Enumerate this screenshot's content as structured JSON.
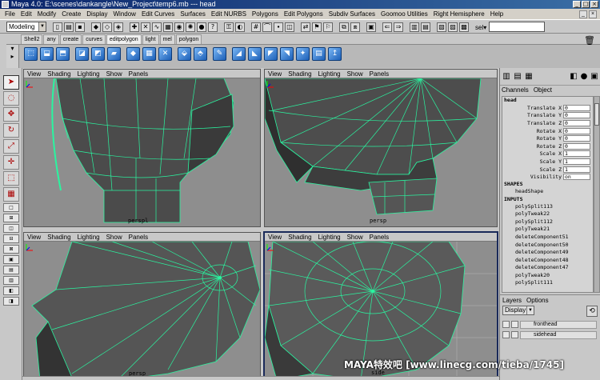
{
  "window": {
    "title": "Maya 4.0: E:\\scenes\\dankangle\\New_Project\\temp6.mb   ---   head",
    "controls": [
      "_",
      "□",
      "×"
    ]
  },
  "menubar": [
    "File",
    "Edit",
    "Modify",
    "Create",
    "Display",
    "Window",
    "Edit Curves",
    "Surfaces",
    "Edit NURBS",
    "Polygons",
    "Edit Polygons",
    "Subdiv Surfaces",
    "Goomoo Utilities",
    "Right Hemisphere",
    "Help"
  ],
  "status": {
    "mode": "Modeling",
    "select_label": "sel▾"
  },
  "shelf": {
    "tabs": [
      "Shell2",
      "any",
      "create",
      "curves",
      "editpolygon",
      "light",
      "mel",
      "polygon"
    ],
    "active_tab": "editpolygon"
  },
  "viewports": [
    {
      "menu": [
        "View",
        "Shading",
        "Lighting",
        "Show",
        "Panels"
      ],
      "label": "perspl"
    },
    {
      "menu": [
        "View",
        "Shading",
        "Lighting",
        "Show",
        "Panels"
      ],
      "label": "persp"
    },
    {
      "menu": [
        "View",
        "Shading",
        "Lighting",
        "Show",
        "Panels"
      ],
      "label": "persp"
    },
    {
      "menu": [
        "View",
        "Shading",
        "Lighting",
        "Show",
        "Panels"
      ],
      "label": "side"
    }
  ],
  "channelbox": {
    "tabs": [
      "Channels",
      "Object"
    ],
    "object": "head",
    "attrs": [
      {
        "name": "Translate X",
        "value": "0"
      },
      {
        "name": "Translate Y",
        "value": "0"
      },
      {
        "name": "Translate Z",
        "value": "0"
      },
      {
        "name": "Rotate X",
        "value": "0"
      },
      {
        "name": "Rotate Y",
        "value": "0"
      },
      {
        "name": "Rotate Z",
        "value": "0"
      },
      {
        "name": "Scale X",
        "value": "1"
      },
      {
        "name": "Scale Y",
        "value": "1"
      },
      {
        "name": "Scale Z",
        "value": "1"
      },
      {
        "name": "Visibility",
        "value": "on"
      }
    ],
    "shapes_header": "SHAPES",
    "shapes": [
      "headShape"
    ],
    "inputs_header": "INPUTS",
    "inputs": [
      "polySplit113",
      "polyTweak22",
      "polySplit112",
      "polyTweak21",
      "deleteComponent51",
      "deleteComponent50",
      "deleteComponent49",
      "deleteComponent48",
      "deleteComponent47",
      "polyTweak20",
      "polySplit111"
    ]
  },
  "layers": {
    "tabs": [
      "Layers",
      "Options"
    ],
    "display": "Display",
    "items": [
      "fronthead",
      "sidehead"
    ]
  },
  "watermark": "MAYA特效吧 [www.linecg.com/tieba/1745]"
}
